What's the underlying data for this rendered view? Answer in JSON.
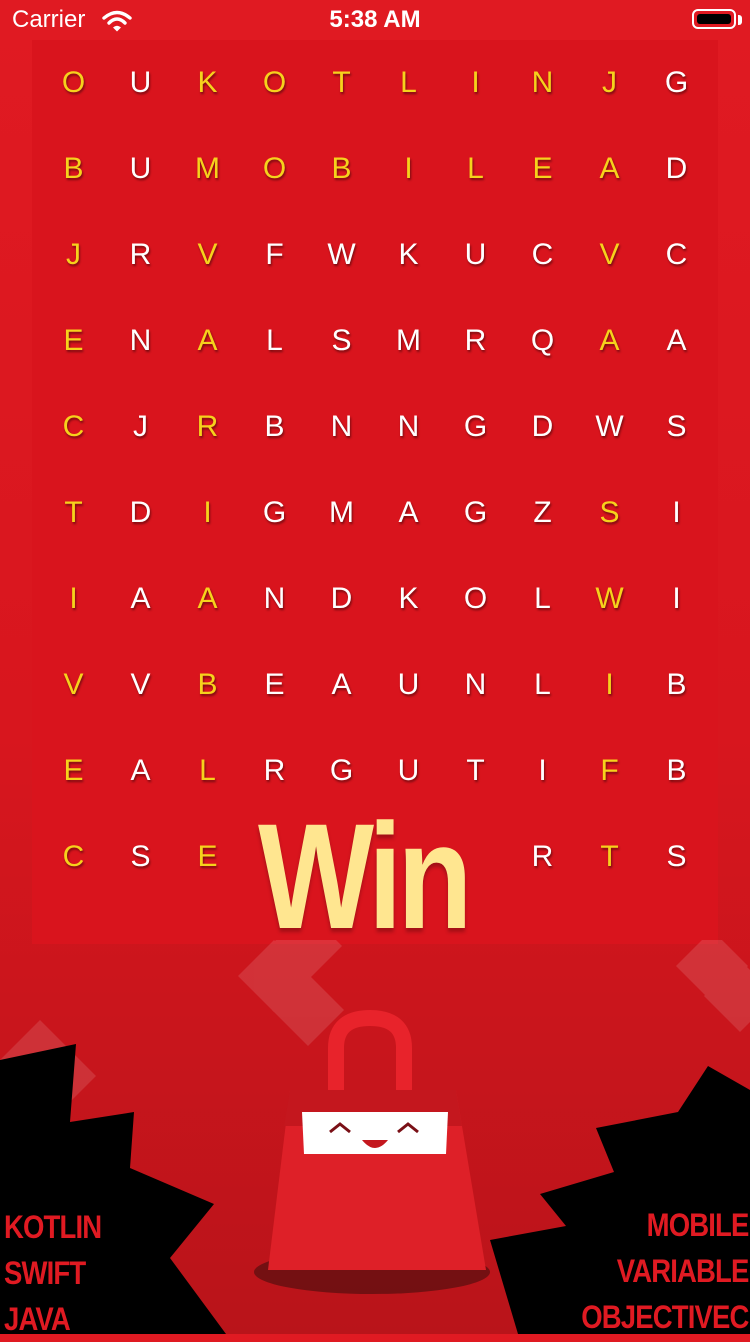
{
  "status_bar": {
    "carrier": "Carrier",
    "time": "5:38 AM",
    "icons": [
      "wifi-icon",
      "battery-icon"
    ]
  },
  "grid": {
    "rows": [
      [
        "O",
        "U",
        "K",
        "O",
        "T",
        "L",
        "I",
        "N",
        "J",
        "G"
      ],
      [
        "B",
        "U",
        "M",
        "O",
        "B",
        "I",
        "L",
        "E",
        "A",
        "D"
      ],
      [
        "J",
        "R",
        "V",
        "F",
        "W",
        "K",
        "U",
        "C",
        "V",
        "C"
      ],
      [
        "E",
        "N",
        "A",
        "L",
        "S",
        "M",
        "R",
        "Q",
        "A",
        "A"
      ],
      [
        "C",
        "J",
        "R",
        "B",
        "N",
        "N",
        "G",
        "D",
        "W",
        "S"
      ],
      [
        "T",
        "D",
        "I",
        "G",
        "M",
        "A",
        "G",
        "Z",
        "S",
        "I"
      ],
      [
        "I",
        "A",
        "A",
        "N",
        "D",
        "K",
        "O",
        "L",
        "W",
        "I"
      ],
      [
        "V",
        "V",
        "B",
        "E",
        "A",
        "U",
        "N",
        "L",
        "I",
        "B"
      ],
      [
        "E",
        "A",
        "L",
        "R",
        "G",
        "U",
        "T",
        "I",
        "F",
        "B"
      ],
      [
        "C",
        "S",
        "E",
        "",
        "",
        "",
        "",
        "R",
        "T",
        "S"
      ]
    ],
    "highlighted": [
      [
        1,
        0,
        1,
        1,
        1,
        1,
        1,
        1,
        1,
        0
      ],
      [
        1,
        0,
        1,
        1,
        1,
        1,
        1,
        1,
        1,
        0
      ],
      [
        1,
        0,
        1,
        0,
        0,
        0,
        0,
        0,
        1,
        0
      ],
      [
        1,
        0,
        1,
        0,
        0,
        0,
        0,
        0,
        1,
        0
      ],
      [
        1,
        0,
        1,
        0,
        0,
        0,
        0,
        0,
        0,
        0
      ],
      [
        1,
        0,
        1,
        0,
        0,
        0,
        0,
        0,
        1,
        0
      ],
      [
        1,
        0,
        1,
        0,
        0,
        0,
        0,
        0,
        1,
        0
      ],
      [
        1,
        0,
        1,
        0,
        0,
        0,
        0,
        0,
        1,
        0
      ],
      [
        1,
        0,
        1,
        0,
        0,
        0,
        0,
        0,
        1,
        0
      ],
      [
        1,
        0,
        1,
        0,
        0,
        0,
        0,
        0,
        1,
        0
      ]
    ],
    "colors": {
      "found": "#f6d21c",
      "normal": "#ffffff"
    }
  },
  "result": {
    "text": "Win",
    "color": "#ffe690"
  },
  "words_left": [
    "KOTLIN",
    "SWIFT",
    "JAVA"
  ],
  "words_right": [
    "MOBILE",
    "VARIABLE",
    "OBJECTIVEC"
  ],
  "decor": {
    "mascot": "shopping-bag-mascot-icon",
    "accent": "#e01a22"
  }
}
